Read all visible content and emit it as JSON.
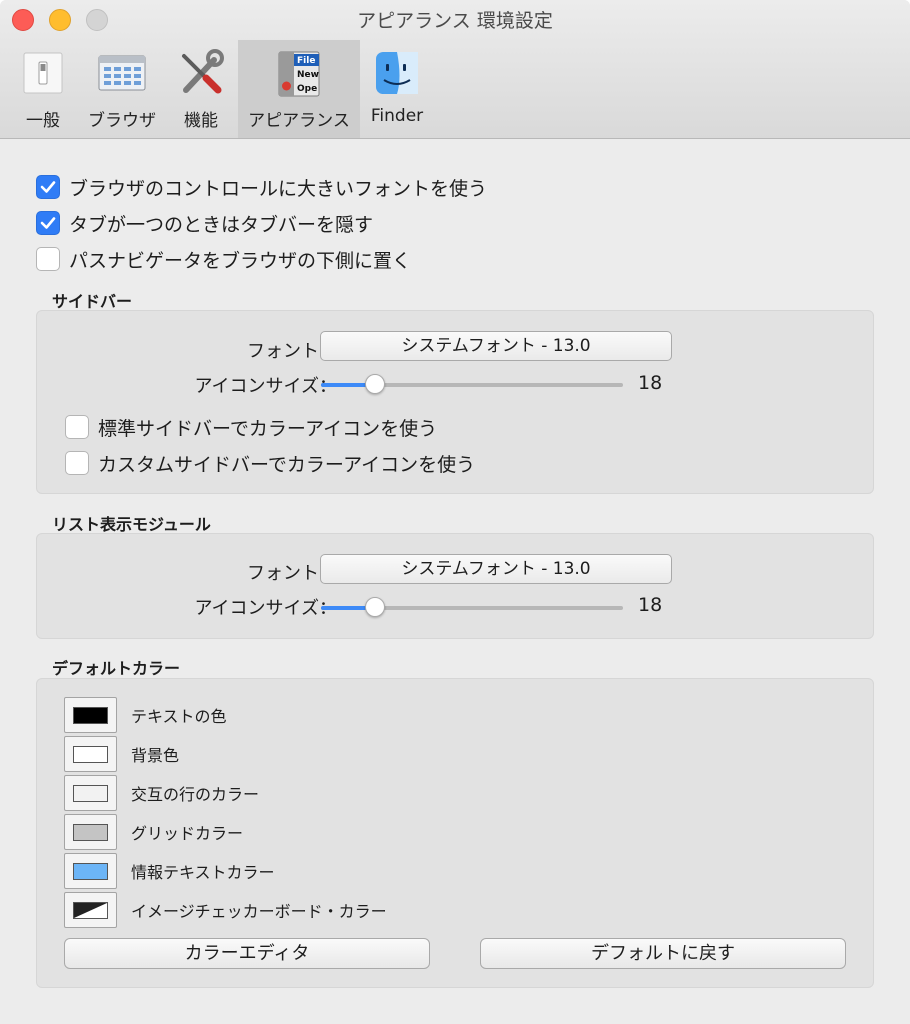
{
  "window": {
    "title": "アピアランス 環境設定"
  },
  "toolbar": {
    "items": [
      {
        "label": "一般",
        "icon": "switch-icon"
      },
      {
        "label": "ブラウザ",
        "icon": "browser-window-icon"
      },
      {
        "label": "機能",
        "icon": "tools-icon"
      },
      {
        "label": "アピアランス",
        "icon": "appearance-menu-icon",
        "selected": true
      },
      {
        "label": "Finder",
        "icon": "finder-icon"
      }
    ],
    "appearance_icon_text": [
      "File",
      "New",
      "Ope"
    ]
  },
  "options": [
    {
      "label": "ブラウザのコントロールに大きいフォントを使う",
      "checked": true
    },
    {
      "label": "タブが一つのときはタブバーを隠す",
      "checked": true
    },
    {
      "label": "パスナビゲータをブラウザの下側に置く",
      "checked": false
    }
  ],
  "sidebar": {
    "title": "サイドバー",
    "font_label": "フォント：",
    "font_value": "システムフォント - 13.0",
    "icon_size_label": "アイコンサイズ：",
    "icon_size_value": "18",
    "icon_size_fraction": 0.18,
    "checkboxes": [
      {
        "label": "標準サイドバーでカラーアイコンを使う",
        "checked": false
      },
      {
        "label": "カスタムサイドバーでカラーアイコンを使う",
        "checked": false
      }
    ]
  },
  "list_module": {
    "title": "リスト表示モジュール",
    "font_label": "フォント：",
    "font_value": "システムフォント - 13.0",
    "icon_size_label": "アイコンサイズ：",
    "icon_size_value": "18",
    "icon_size_fraction": 0.18
  },
  "default_colors": {
    "title": "デフォルトカラー",
    "items": [
      {
        "label": "テキストの色",
        "color": "#000000"
      },
      {
        "label": "背景色",
        "color": "#ffffff"
      },
      {
        "label": "交互の行のカラー",
        "color": "#f2f2f2"
      },
      {
        "label": "グリッドカラー",
        "color": "#c4c4c4"
      },
      {
        "label": "情報テキストカラー",
        "color": "#6cb5f7"
      },
      {
        "label": "イメージチェッカーボード・カラー",
        "color": "checkerboard"
      }
    ],
    "color_editor_button": "カラーエディタ",
    "reset_button": "デフォルトに戻す"
  },
  "colors": {
    "accent": "#2f7cf6",
    "slider_fill": "#3d8af7"
  }
}
